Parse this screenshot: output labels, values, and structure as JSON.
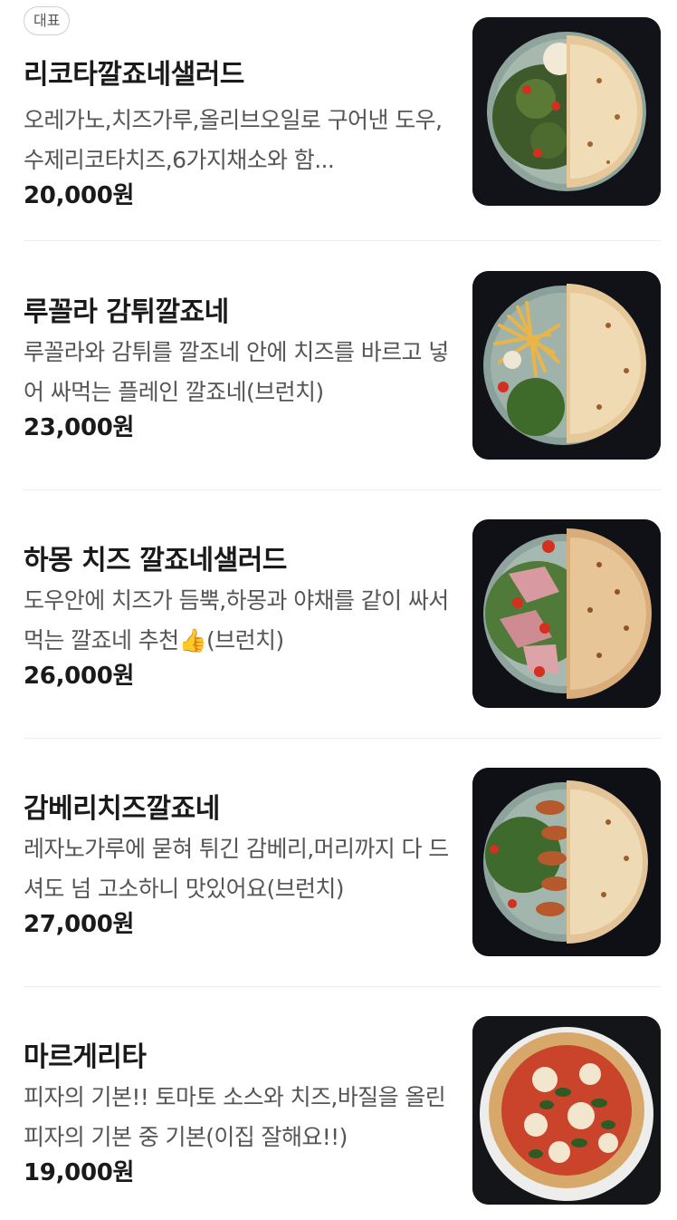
{
  "menu": {
    "items": [
      {
        "badge": "대표",
        "name": "리코타깔죠네샐러드",
        "desc": "오레가노,치즈가루,올리브오일로 구어낸 도우,수제리코타치즈,6가지채소와 함...",
        "price": "20,000원",
        "image": "calzone-with-ricotta-salad"
      },
      {
        "name": "루꼴라 감튀깔죠네",
        "desc": "루꼴라와 감튀를 깔조네 안에 치즈를 바르고 넣어 싸먹는 플레인 깔죠네(브런치)",
        "price": "23,000원",
        "image": "calzone-with-fries-and-arugula"
      },
      {
        "name": "하몽 치즈 깔죠네샐러드",
        "desc": "도우안에 치즈가 듬뿍,하몽과 야채를 같이 싸서 먹는 깔죠네 추천👍(브런치)",
        "price": "26,000원",
        "image": "calzone-with-jamon-salad"
      },
      {
        "name": "감베리치즈깔죠네",
        "desc": "레자노가루에 묻혀 튀긴 감베리,머리까지 다 드셔도 넘 고소하니 맛있어요(브런치)",
        "price": "27,000원",
        "image": "calzone-with-fried-shrimp"
      },
      {
        "name": "마르게리타",
        "desc": "피자의 기본!! 토마토 소스와 치즈,바질을 올린 피자의 기본 중 기본(이집 잘해요!!)",
        "price": "19,000원",
        "image": "margherita-pizza"
      }
    ]
  }
}
